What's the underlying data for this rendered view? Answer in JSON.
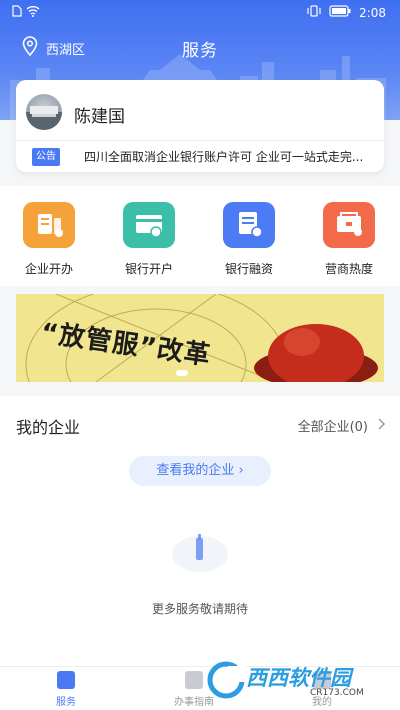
{
  "status_bar": {
    "time": "2:08"
  },
  "header": {
    "location": "西湖区",
    "title": "服务"
  },
  "profile": {
    "name": "陈建国"
  },
  "notice": {
    "tag": "公告",
    "text": "四川全面取消企业银行账户许可 企业可一站式走完..."
  },
  "services": [
    {
      "label": "企业开办",
      "icon": "business-setup-icon",
      "color": "#f6a23a"
    },
    {
      "label": "银行开户",
      "icon": "bank-card-icon",
      "color": "#3bbfa8"
    },
    {
      "label": "银行融资",
      "icon": "bank-finance-icon",
      "color": "#4c7cf3"
    },
    {
      "label": "营商热度",
      "icon": "business-heat-icon",
      "color": "#f26a4a"
    }
  ],
  "banner": {
    "text": "“放管服”改革"
  },
  "my_company": {
    "title": "我的企业",
    "all_label": "全部企业(0)",
    "view_button": "查看我的企业 ›",
    "empty_text": "更多服务敬请期待"
  },
  "tabbar": [
    {
      "label": "服务",
      "active": true
    },
    {
      "label": "办事指南",
      "active": false
    },
    {
      "label": "我的",
      "active": false
    }
  ],
  "watermark": {
    "brand": "西西软件园",
    "url": "CR173.COM"
  },
  "colors": {
    "primary": "#4a7af3"
  }
}
